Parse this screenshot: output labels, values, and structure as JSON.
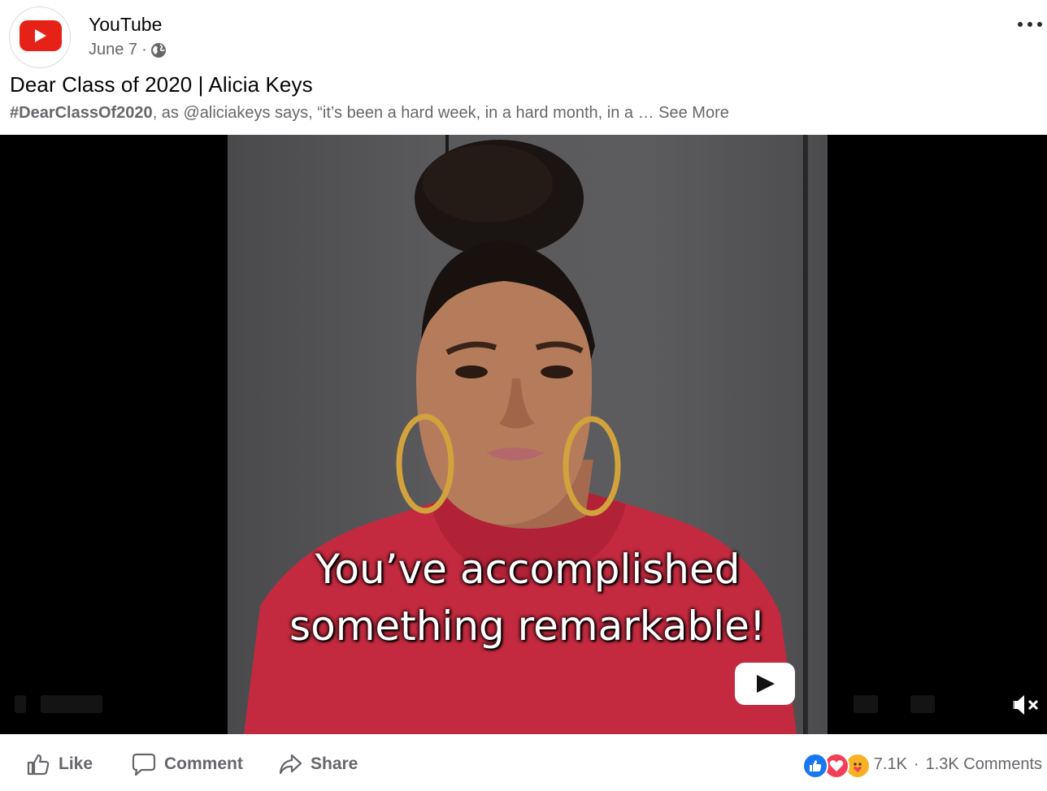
{
  "post": {
    "author": "YouTube",
    "date": "June 7",
    "separator": "·",
    "title": "Dear Class of 2020 | Alicia Keys",
    "hashtag": "#DearClassOf2020",
    "description": ", as @aliciakeys says, “it’s been a hard week, in a hard month, in a … ",
    "see_more": "See More"
  },
  "video": {
    "caption_line1": "You’ve accomplished",
    "caption_line2": "something remarkable!"
  },
  "actions": {
    "like": "Like",
    "comment": "Comment",
    "share": "Share"
  },
  "engagement": {
    "reactions_count": "7.1K",
    "separator": "·",
    "comments": "1.3K Comments"
  },
  "colors": {
    "youtube_red": "#e62117",
    "like_blue": "#1877f2",
    "love_red": "#f33e58",
    "care_yellow": "#f7b125",
    "secondary_text": "#65676b",
    "sweater_red": "#c8283d"
  },
  "icons": [
    "youtube-logo-icon",
    "globe-icon",
    "more-options-icon",
    "play-icon",
    "mute-icon",
    "like-icon",
    "comment-icon",
    "share-icon",
    "like-reaction-icon",
    "love-reaction-icon",
    "care-reaction-icon"
  ]
}
